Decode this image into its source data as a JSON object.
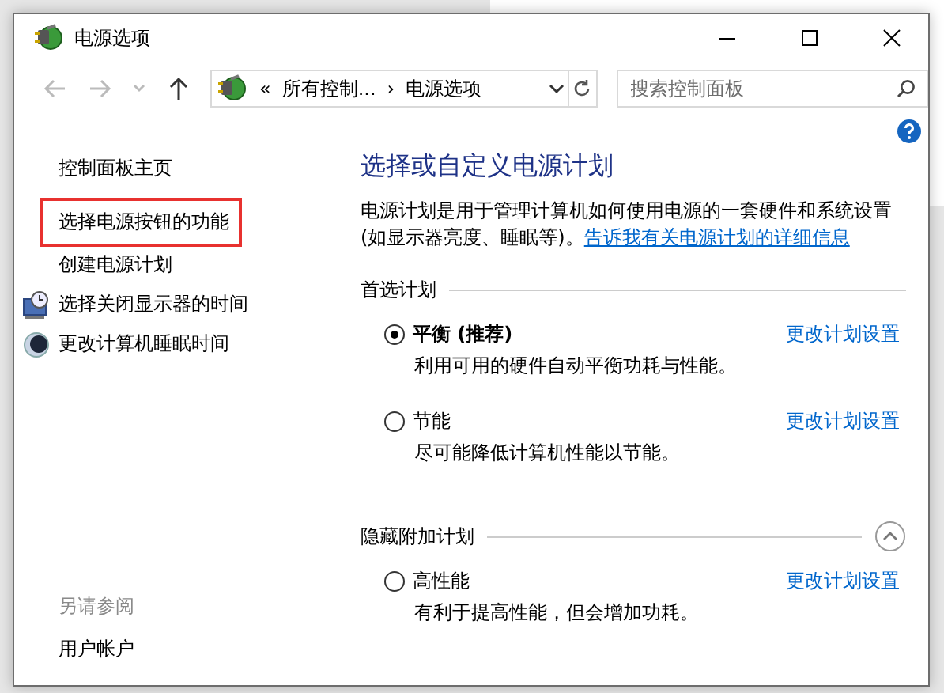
{
  "window": {
    "title": "电源选项"
  },
  "nav": {
    "back_enabled": false,
    "forward_enabled": false,
    "overflow_mark": "«",
    "breadcrumbs": [
      "所有控制...",
      "电源选项"
    ],
    "separator": "›",
    "search": {
      "placeholder": "搜索控制面板"
    }
  },
  "sidebar": {
    "home": "控制面板主页",
    "items": [
      {
        "label": "选择电源按钮的功能",
        "highlighted": true
      },
      {
        "label": "创建电源计划",
        "highlighted": false
      },
      {
        "label": "选择关闭显示器的时间",
        "highlighted": false
      },
      {
        "label": "更改计算机睡眠时间",
        "highlighted": false
      }
    ],
    "see_also": {
      "title": "另请参阅",
      "links": [
        "用户帐户"
      ]
    }
  },
  "main": {
    "title": "选择或自定义电源计划",
    "description": "电源计划是用于管理计算机如何使用电源的一套硬件和系统设置(如显示器亮度、睡眠等)。",
    "description_link": "告诉我有关电源计划的详细信息",
    "groups": [
      {
        "title": "首选计划",
        "plans": [
          {
            "name": "平衡 (推荐)",
            "selected": true,
            "description": "利用可用的硬件自动平衡功耗与性能。",
            "link": "更改计划设置"
          },
          {
            "name": "节能",
            "selected": false,
            "description": "尽可能降低计算机性能以节能。",
            "link": "更改计划设置"
          }
        ]
      },
      {
        "title": "隐藏附加计划",
        "expanded": true,
        "plans": [
          {
            "name": "高性能",
            "selected": false,
            "description": "有利于提高性能，但会增加功耗。",
            "link": "更改计划设置"
          }
        ]
      }
    ]
  }
}
